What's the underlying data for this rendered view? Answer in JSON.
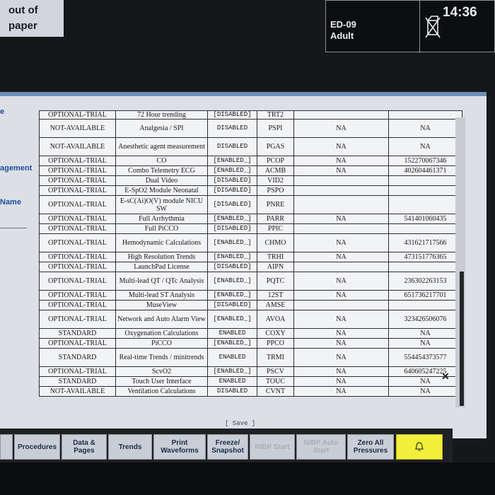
{
  "status": {
    "paper_line1": "out of",
    "paper_line2": "paper",
    "bed_id": "ED-09",
    "patient_category": "Adult",
    "time": "14:36"
  },
  "side_labels": [
    "e",
    "agement",
    "Name"
  ],
  "rows": [
    {
      "status": "OPTIONAL-TRIAL",
      "feature": "72 Hour trending",
      "state": "[DISABLED]",
      "code": "TRT2",
      "trial": "",
      "id": ""
    },
    {
      "status": "NOT-AVAILABLE",
      "feature": "Analgesia / SPI",
      "state": "DISABLED",
      "code": "PSPI",
      "trial": "NA",
      "id": "NA"
    },
    {
      "status": "NOT-AVAILABLE",
      "feature": "Anesthetic agent measurement",
      "state": "DISABLED",
      "code": "PGAS",
      "trial": "NA",
      "id": "NA"
    },
    {
      "status": "OPTIONAL-TRIAL",
      "feature": "CO",
      "state": "[ENABLED_]",
      "code": "PCOP",
      "trial": "NA",
      "id": "152270067346"
    },
    {
      "status": "OPTIONAL-TRIAL",
      "feature": "Combo Telemetry ECG",
      "state": "[ENABLED_]",
      "code": "ACMB",
      "trial": "NA",
      "id": "402604461371"
    },
    {
      "status": "OPTIONAL-TRIAL",
      "feature": "Dual Video",
      "state": "[DISABLED]",
      "code": "VID2",
      "trial": "",
      "id": ""
    },
    {
      "status": "OPTIONAL-TRIAL",
      "feature": "E-SpO2 Module Neonatal",
      "state": "[DISABLED]",
      "code": "PSPO",
      "trial": "",
      "id": ""
    },
    {
      "status": "OPTIONAL-TRIAL",
      "feature": "E-sC(Ai)O(V) module NICU SW",
      "state": "[DISABLED]",
      "code": "PNRE",
      "trial": "",
      "id": ""
    },
    {
      "status": "OPTIONAL-TRIAL",
      "feature": "Full Arrhythmia",
      "state": "[ENABLED_]",
      "code": "PARR",
      "trial": "NA",
      "id": "541401060435"
    },
    {
      "status": "OPTIONAL-TRIAL",
      "feature": "Full PiCCO",
      "state": "[DISABLED]",
      "code": "PPIC",
      "trial": "",
      "id": ""
    },
    {
      "status": "OPTIONAL-TRIAL",
      "feature": "Hemodynamic Calculations",
      "state": "[ENABLED_]",
      "code": "CHMO",
      "trial": "NA",
      "id": "431621717566"
    },
    {
      "status": "OPTIONAL-TRIAL",
      "feature": "High Resolution Trends",
      "state": "[ENABLED_]",
      "code": "TRHI",
      "trial": "NA",
      "id": "473151776365"
    },
    {
      "status": "OPTIONAL-TRIAL",
      "feature": "LaunchPad License",
      "state": "[DISABLED]",
      "code": "AIPN",
      "trial": "",
      "id": ""
    },
    {
      "status": "OPTIONAL-TRIAL",
      "feature": "Multi-lead QT / QTc Analysis",
      "state": "[ENABLED_]",
      "code": "PQTC",
      "trial": "NA",
      "id": "236302263153"
    },
    {
      "status": "OPTIONAL-TRIAL",
      "feature": "Multi-lead ST Analysis",
      "state": "[ENABLED_]",
      "code": "12ST",
      "trial": "NA",
      "id": "651736217701"
    },
    {
      "status": "OPTIONAL-TRIAL",
      "feature": "MuseView",
      "state": "[DISABLED]",
      "code": "AMSE",
      "trial": "",
      "id": ""
    },
    {
      "status": "OPTIONAL-TRIAL",
      "feature": "Network and Auto Alarm View",
      "state": "[ENABLED_]",
      "code": "AVOA",
      "trial": "NA",
      "id": "323426506076"
    },
    {
      "status": "STANDARD",
      "feature": "Oxygenation Calculations",
      "state": "ENABLED",
      "code": "COXY",
      "trial": "NA",
      "id": "NA"
    },
    {
      "status": "OPTIONAL-TRIAL",
      "feature": "PiCCO",
      "state": "[ENABLED_]",
      "code": "PPCO",
      "trial": "NA",
      "id": "NA"
    },
    {
      "status": "STANDARD",
      "feature": "Real-time Trends / minitrends",
      "state": "ENABLED",
      "code": "TRMI",
      "trial": "NA",
      "id": "554454373577"
    },
    {
      "status": "OPTIONAL-TRIAL",
      "feature": "ScvO2",
      "state": "[ENABLED_]",
      "code": "PSCV",
      "trial": "NA",
      "id": "640605247225"
    },
    {
      "status": "STANDARD",
      "feature": "Touch User Interface",
      "state": "ENABLED",
      "code": "TOUC",
      "trial": "NA",
      "id": "NA"
    },
    {
      "status": "NOT-AVAILABLE",
      "feature": "Ventilation Calculations",
      "state": "DISABLED",
      "code": "CVNT",
      "trial": "NA",
      "id": "NA"
    }
  ],
  "save_label": "[ Save ]",
  "toolbar": {
    "procedures": "Procedures",
    "data_pages": "Data & Pages",
    "trends": "Trends",
    "print_waveforms": "Print Waveforms",
    "freeze_snapshot": "Freeze/ Snapshot",
    "nibp_start": "NIBP Start",
    "nibp_auto_start": "NIBP Auto Start",
    "zero_all_pressures": "Zero All Pressures"
  },
  "colors": {
    "title_bar": "#6c8fb6",
    "alarm_button": "#f1ef3a",
    "side_label": "#1f4f9c"
  }
}
